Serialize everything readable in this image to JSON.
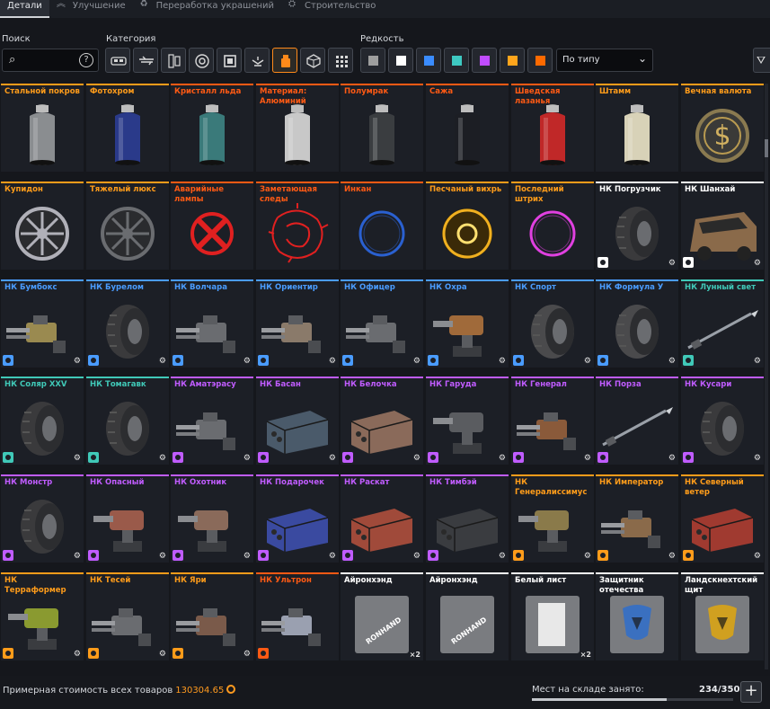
{
  "tabs": [
    {
      "label": "Детали",
      "icon": "box-icon",
      "active": true
    },
    {
      "label": "Улучшение",
      "icon": "upgrade-chevrons-icon",
      "active": false
    },
    {
      "label": "Переработка украшений",
      "icon": "recycle-icon",
      "active": false
    },
    {
      "label": "Строительство",
      "icon": "build-icon",
      "active": false
    }
  ],
  "filters": {
    "search_label": "Поиск",
    "search_value": "",
    "category_label": "Категория",
    "rarity_label": "Редкость",
    "sort_value": "По типу",
    "categories": [
      "cabin-icon",
      "weapon-icon",
      "module-icon",
      "wheel-icon",
      "frame-icon",
      "drone-icon",
      "paint-icon",
      "cube-icon",
      "grid-icon"
    ],
    "active_category": 6,
    "rarity_colors": [
      "#9e9e9e",
      "#ffffff",
      "#3a8cff",
      "#3ec9c2",
      "#c04cff",
      "#ffa51c",
      "#ff6a00"
    ]
  },
  "colors": {
    "grey": "#9ea1a6",
    "white": "#ffffff",
    "blue": "#4a9cff",
    "teal": "#40c9b8",
    "purple": "#c05cff",
    "orange": "#ff9c1a",
    "red": "#ff5a14"
  },
  "items": [
    {
      "name": "Стальной покров",
      "rarity": "orange",
      "art": "can",
      "tint": "#8a8d90"
    },
    {
      "name": "Фотохром",
      "rarity": "orange",
      "art": "can",
      "tint": "#2a3a8a"
    },
    {
      "name": "Кристалл льда",
      "rarity": "red",
      "art": "can",
      "tint": "#3a7a7a"
    },
    {
      "name": "Материал: Алюминий",
      "rarity": "red",
      "art": "can",
      "tint": "#c8c8c8"
    },
    {
      "name": "Полумрак",
      "rarity": "red",
      "art": "can",
      "tint": "#3a3d40"
    },
    {
      "name": "Сажа",
      "rarity": "red",
      "art": "can",
      "tint": "#1c1e24"
    },
    {
      "name": "Шведская лазанья",
      "rarity": "red",
      "art": "can",
      "tint": "#c02828"
    },
    {
      "name": "Штамм",
      "rarity": "orange",
      "art": "can",
      "tint": "#d8d2b8"
    },
    {
      "name": "Вечная валюта",
      "rarity": "orange",
      "art": "coin",
      "tint": "#8a7a50"
    },
    {
      "name": "Купидон",
      "rarity": "orange",
      "art": "rim",
      "tint": "#b0b0b8"
    },
    {
      "name": "Тяжелый люкс",
      "rarity": "orange",
      "art": "rim",
      "tint": "#6a6c70"
    },
    {
      "name": "Аварийные лампы",
      "rarity": "red",
      "art": "xsign",
      "tint": "#e02020"
    },
    {
      "name": "Заметающая следы",
      "rarity": "red",
      "art": "splash",
      "tint": "#e02020"
    },
    {
      "name": "Инкан",
      "rarity": "red",
      "art": "ring",
      "tint": "#2a60d0"
    },
    {
      "name": "Песчаный вихрь",
      "rarity": "orange",
      "art": "vortex",
      "tint": "#f0b020"
    },
    {
      "name": "Последний штрих",
      "rarity": "orange",
      "art": "ring",
      "tint": "#e040e0"
    },
    {
      "name": "НК Погрузчик",
      "rarity": "white",
      "art": "wheel",
      "tint": "#3a3a3c",
      "gear": true
    },
    {
      "name": "НК Шанхай",
      "rarity": "white",
      "art": "cabin",
      "tint": "#8a6a4a",
      "gear": true
    },
    {
      "name": "НК Бумбокс",
      "rarity": "blue",
      "art": "weapon",
      "tint": "#9a8a50",
      "gear": true
    },
    {
      "name": "НК Бурелом",
      "rarity": "blue",
      "art": "wheel",
      "tint": "#3a3a3c",
      "gear": true
    },
    {
      "name": "НК Волчара",
      "rarity": "blue",
      "art": "weapon",
      "tint": "#6a6c70",
      "gear": true
    },
    {
      "name": "НК Ориентир",
      "rarity": "blue",
      "art": "weapon",
      "tint": "#8a7a6a",
      "gear": true
    },
    {
      "name": "НК Офицер",
      "rarity": "blue",
      "art": "weapon",
      "tint": "#6a6c70",
      "gear": true
    },
    {
      "name": "НК Охра",
      "rarity": "blue",
      "art": "turret",
      "tint": "#a06a3a",
      "gear": true
    },
    {
      "name": "НК Спорт",
      "rarity": "blue",
      "art": "wheel",
      "tint": "#4a4a4c",
      "gear": true
    },
    {
      "name": "НК Формула У",
      "rarity": "blue",
      "art": "wheel",
      "tint": "#4a4a4c",
      "gear": true
    },
    {
      "name": "НК Лунный свет",
      "rarity": "teal",
      "art": "spear",
      "tint": "#9aa0a8",
      "gear": true
    },
    {
      "name": "НК Соляр XXV",
      "rarity": "teal",
      "art": "wheel",
      "tint": "#3a3a3c",
      "gear": true
    },
    {
      "name": "НК Томагавк",
      "rarity": "teal",
      "art": "wheel",
      "tint": "#3a3a3c",
      "gear": true
    },
    {
      "name": "НК Аматэрасу",
      "rarity": "purple",
      "art": "weapon",
      "tint": "#6a6c70",
      "gear": true
    },
    {
      "name": "НК Басан",
      "rarity": "purple",
      "art": "box",
      "tint": "#4a5a6a",
      "gear": true
    },
    {
      "name": "НК Белочка",
      "rarity": "purple",
      "art": "box",
      "tint": "#8a6a5a",
      "gear": true
    },
    {
      "name": "НК Гаруда",
      "rarity": "purple",
      "art": "turret",
      "tint": "#5a5c60",
      "gear": true
    },
    {
      "name": "НК Генерал",
      "rarity": "purple",
      "art": "weapon",
      "tint": "#8a5a3a",
      "gear": true
    },
    {
      "name": "НК Порза",
      "rarity": "purple",
      "art": "spear",
      "tint": "#9aa0a8",
      "gear": true
    },
    {
      "name": "НК Кусари",
      "rarity": "purple",
      "art": "wheel",
      "tint": "#3a3a3c",
      "gear": true
    },
    {
      "name": "НК Монстр",
      "rarity": "purple",
      "art": "wheel",
      "tint": "#3a3a3c",
      "gear": true
    },
    {
      "name": "НК Опасный",
      "rarity": "purple",
      "art": "turret",
      "tint": "#9a5a4a",
      "gear": true
    },
    {
      "name": "НК Охотник",
      "rarity": "purple",
      "art": "turret",
      "tint": "#8a6a5a",
      "gear": true
    },
    {
      "name": "НК Подарочек",
      "rarity": "purple",
      "art": "box",
      "tint": "#3a4aa0",
      "gear": true
    },
    {
      "name": "НК Раскат",
      "rarity": "purple",
      "art": "box",
      "tint": "#a04a3a",
      "gear": true
    },
    {
      "name": "НК Тимбэй",
      "rarity": "purple",
      "art": "box",
      "tint": "#3a3c40",
      "gear": true
    },
    {
      "name": "НК Генералиссимус",
      "rarity": "orange",
      "art": "turret",
      "tint": "#8a7a4a",
      "gear": true
    },
    {
      "name": "НК Император",
      "rarity": "orange",
      "art": "weapon",
      "tint": "#8a6a4a",
      "gear": true
    },
    {
      "name": "НК Северный ветер",
      "rarity": "orange",
      "art": "box",
      "tint": "#a03a30",
      "gear": true
    },
    {
      "name": "НК Терраформер",
      "rarity": "orange",
      "art": "turret",
      "tint": "#8a9a30",
      "gear": true
    },
    {
      "name": "НК Тесей",
      "rarity": "orange",
      "art": "weapon",
      "tint": "#6a6c70",
      "gear": true
    },
    {
      "name": "НК Яри",
      "rarity": "orange",
      "art": "weapon",
      "tint": "#7a5a4a",
      "gear": true
    },
    {
      "name": "НК Ультрон",
      "rarity": "red",
      "art": "weapon",
      "tint": "#9aa0b0",
      "gear": false
    },
    {
      "name": "Айронхэнд",
      "rarity": "white",
      "art": "sticker",
      "tint": "#7a7c80",
      "qty": "×2",
      "badge": false
    },
    {
      "name": "Айронхэнд",
      "rarity": "white",
      "art": "sticker",
      "tint": "#7a7c80",
      "badge": false
    },
    {
      "name": "Белый лист",
      "rarity": "white",
      "art": "sheet",
      "tint": "#e8e8e8",
      "qty": "×2",
      "badge": false
    },
    {
      "name": "Защитник отечества",
      "rarity": "white",
      "art": "emblem",
      "tint": "#3a70c0",
      "badge": false
    },
    {
      "name": "Ландскнехтский щит",
      "rarity": "white",
      "art": "emblem",
      "tint": "#d0a020",
      "badge": false
    }
  ],
  "footer": {
    "cost_label": "Примерная стоимость всех товаров",
    "cost_value": "130304.65",
    "storage_label": "Мест на складе занято:",
    "storage_value": "234/350",
    "storage_fraction": 0.6686
  }
}
